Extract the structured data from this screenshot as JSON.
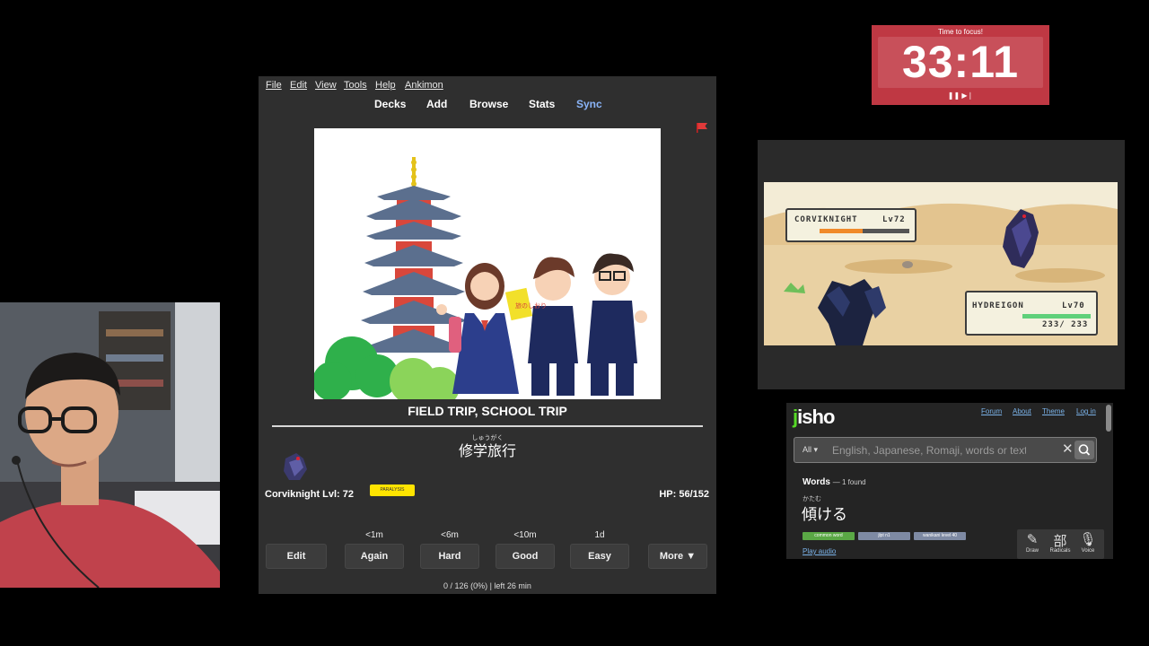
{
  "anki": {
    "menu": [
      "File",
      "Edit",
      "View",
      "Tools",
      "Help",
      "Ankimon"
    ],
    "toplinks": [
      "Decks",
      "Add",
      "Browse",
      "Stats",
      "Sync"
    ],
    "card": {
      "english": "FIELD TRIP, SCHOOL TRIP",
      "furigana": "しゅうがく",
      "kanji": "修学旅行",
      "sign_text": "旅のしおり"
    },
    "pet": {
      "name": "Corviknight Lvl: 72",
      "status": "PARALYSIS",
      "hp": "HP: 56/152"
    },
    "answer": {
      "intervals": [
        "<1m",
        "<6m",
        "<10m",
        "1d"
      ],
      "buttons": [
        "Edit",
        "Again",
        "Hard",
        "Good",
        "Easy",
        "More ▼"
      ]
    },
    "progress": "0 / 126 (0%) | left 26 min",
    "colors": {
      "sync": "#8ab4f8",
      "flag": "#e03a3a"
    }
  },
  "timer": {
    "title": "Time to focus!",
    "value": "33:11",
    "controls": "❚❚ ▶❘"
  },
  "game": {
    "enemy": {
      "name": "CORVIKNIGHT",
      "level": "Lv72",
      "hp_fraction": 0.48
    },
    "player": {
      "name": "HYDREIGON",
      "level": "Lv70",
      "hp_text": "233/ 233",
      "hp_fraction": 1.0
    }
  },
  "jisho": {
    "logo": "jisho",
    "nav": [
      "Forum",
      "About",
      "Theme",
      "Log in"
    ],
    "search": {
      "filter": "All ▾",
      "placeholder": "English, Japanese, Romaji, words or text"
    },
    "results_heading": "Words",
    "results_count": "— 1 found",
    "furigana": "かたむ",
    "word": "傾ける",
    "tags": [
      "common word",
      "jlpt n1",
      "wanikani level 40"
    ],
    "play_audio": "Play audio",
    "tools": [
      {
        "label": "Draw",
        "icon": "✎"
      },
      {
        "label": "Radicals",
        "icon": "部"
      },
      {
        "label": "Voice",
        "icon": "🎙"
      }
    ]
  }
}
